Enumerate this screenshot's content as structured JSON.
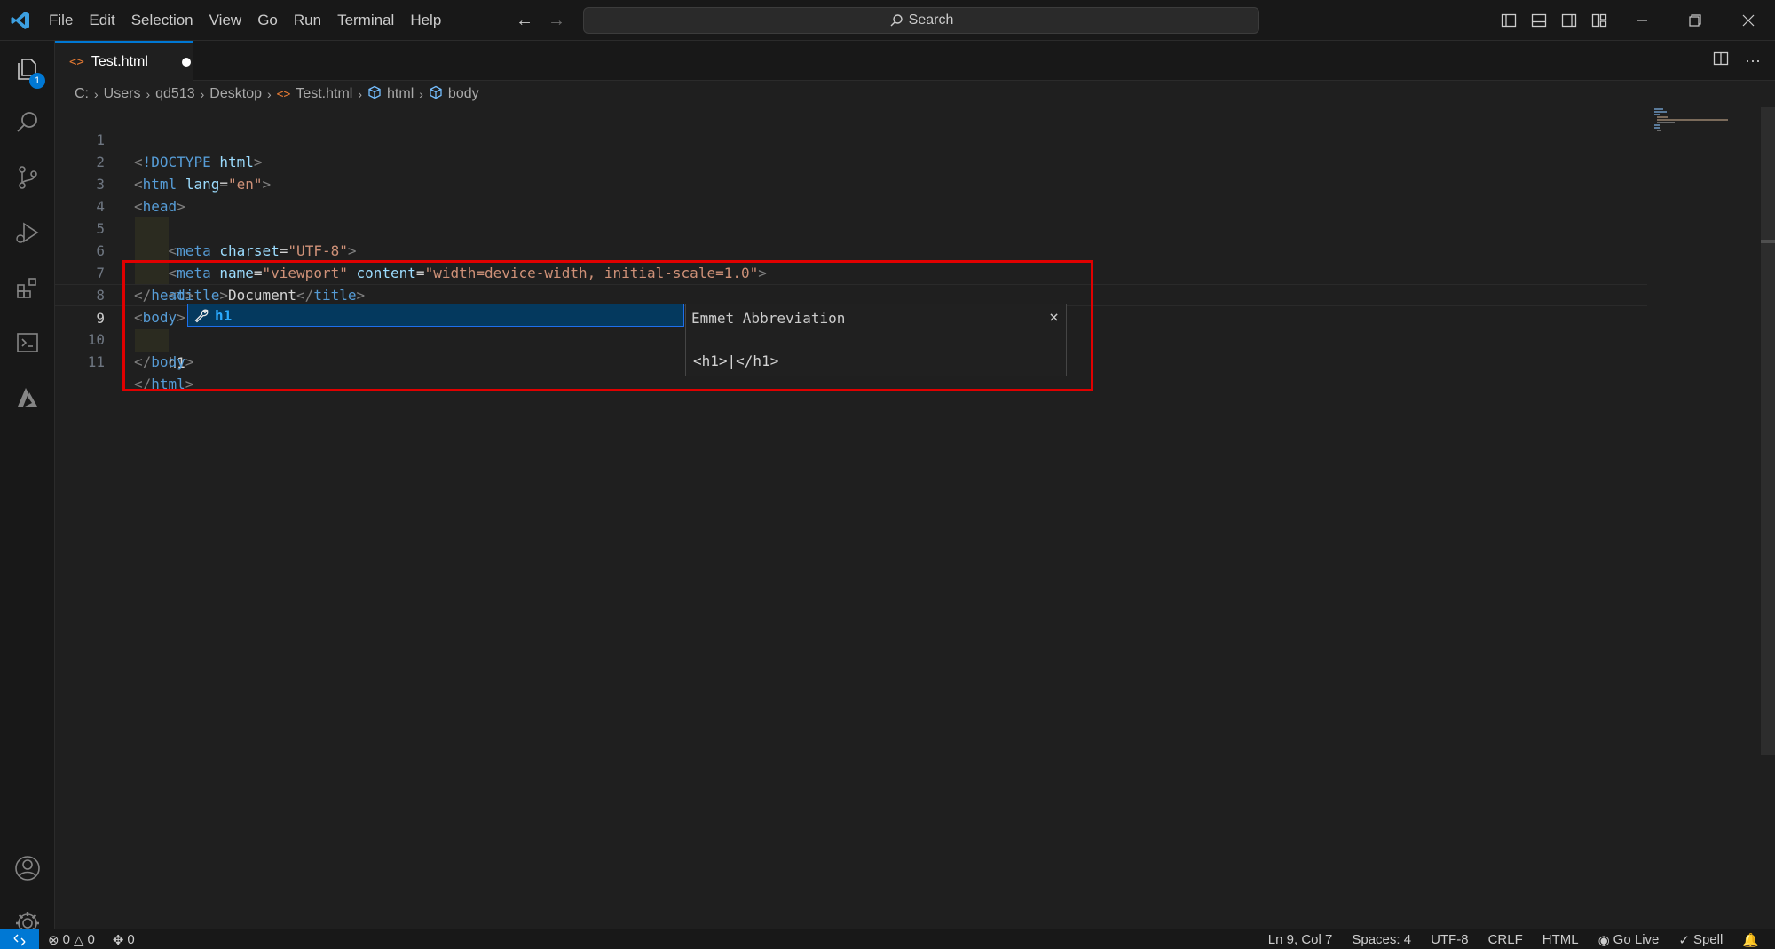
{
  "menu": [
    "File",
    "Edit",
    "Selection",
    "View",
    "Go",
    "Run",
    "Terminal",
    "Help"
  ],
  "search": {
    "label": "Search"
  },
  "activity": {
    "explorer_badge": "1"
  },
  "tab": {
    "filename": "Test.html"
  },
  "breadcrumb": [
    "C:",
    "Users",
    "qd513",
    "Desktop",
    "Test.html",
    "html",
    "body"
  ],
  "editor": {
    "line_numbers": [
      "1",
      "2",
      "3",
      "4",
      "5",
      "6",
      "7",
      "8",
      "9",
      "10",
      "11"
    ],
    "active_line": "9"
  },
  "suggest": {
    "label": "h1",
    "details_title": "Emmet Abbreviation",
    "details_body": "<h1>|</h1>"
  },
  "status": {
    "errors": "0",
    "warnings": "0",
    "ports": "0",
    "position": "Ln 9, Col 7",
    "spaces": "Spaces: 4",
    "encoding": "UTF-8",
    "eol": "CRLF",
    "language": "HTML",
    "golive": "Go Live",
    "spell": "Spell"
  },
  "colors": {
    "accent": "#0078d4",
    "highlight": "#e00000",
    "tag": "#569cd6",
    "attr": "#9cdcfe",
    "string": "#ce9178"
  }
}
